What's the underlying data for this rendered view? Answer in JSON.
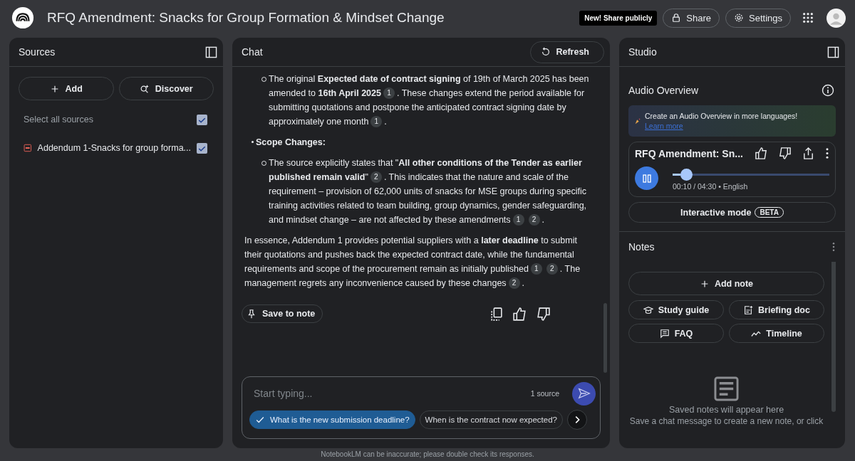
{
  "header": {
    "title": "RFQ Amendment: Snacks for Group Formation & Mindset Change",
    "promo": "New! Share publicly",
    "share": "Share",
    "settings": "Settings"
  },
  "sources": {
    "title": "Sources",
    "add": "Add",
    "discover": "Discover",
    "select_all": {
      "label": "Select all sources",
      "checked": true
    },
    "items": [
      {
        "name": "Addendum 1-Snacks for group forma...",
        "checked": true
      }
    ]
  },
  "chat": {
    "title": "Chat",
    "refresh": "Refresh",
    "blocks": [
      {
        "kind": "sub",
        "parts": [
          {
            "kind": "text",
            "text": "The original **Expected date of contract signing** of 19th of March 2025 has been amended to **16th April 2025**"
          },
          {
            "kind": "cite",
            "text": "1"
          },
          {
            "kind": "text",
            "text": ". These changes extend the period available for submitting quotations and postpone the anticipated contract signing date by approximately one month"
          },
          {
            "kind": "cite",
            "text": "1"
          },
          {
            "kind": "text",
            "text": "."
          }
        ]
      },
      {
        "kind": "bullet",
        "parts": [
          {
            "kind": "text",
            "text": "**Scope Changes:**"
          }
        ]
      },
      {
        "kind": "sub",
        "parts": [
          {
            "kind": "text",
            "text": "The source explicitly states that \"**All other conditions of the Tender as earlier published remain valid**\""
          },
          {
            "kind": "cite",
            "text": "2"
          },
          {
            "kind": "text",
            "text": ". This indicates that the nature and scale of the requirement – provision of 62,000 units of snacks for MSE groups during specific training activities related to team building, group dynamics, gender safeguarding, and mindset change – are not affected by these amendments"
          },
          {
            "kind": "cite",
            "text": "1"
          },
          {
            "kind": "cite",
            "text": "2"
          },
          {
            "kind": "text",
            "text": "."
          }
        ]
      },
      {
        "kind": "para",
        "parts": [
          {
            "kind": "text",
            "text": "In essence, Addendum 1 provides potential suppliers with a **later deadline** to submit their quotations and pushes back the expected contract date, while the fundamental requirements and scope of the procurement remain as initially published"
          },
          {
            "kind": "cite",
            "text": "1"
          },
          {
            "kind": "cite",
            "text": "2"
          },
          {
            "kind": "text",
            "text": ". The management regrets any inconvenience caused by these changes"
          },
          {
            "kind": "cite",
            "text": "2"
          },
          {
            "kind": "text",
            "text": "."
          }
        ]
      }
    ],
    "save_to_note": "Save to note",
    "input": {
      "placeholder": "Start typing...",
      "source_count": "1 source"
    },
    "suggestions": [
      {
        "text": "What is the new submission deadline?",
        "selected": true
      },
      {
        "text": "When is the contract now expected?",
        "selected": false
      }
    ],
    "disclaimer": "NotebookLM can be inaccurate; please double check its responses."
  },
  "studio": {
    "title": "Studio",
    "audio_title": "Audio Overview",
    "banner": "Create an Audio Overview in more languages!",
    "banner_link": "Learn more",
    "player": {
      "title": "RFQ Amendment: Sn...",
      "level": 0.05,
      "meta": "00:10 / 04:30 • English",
      "playing": true
    },
    "interactive": "Interactive mode",
    "beta": "BETA",
    "notes_title": "Notes",
    "add_note": "Add note",
    "note_buttons": [
      {
        "kind": "study",
        "label": "Study guide"
      },
      {
        "kind": "briefing",
        "label": "Briefing doc"
      },
      {
        "kind": "faq",
        "label": "FAQ"
      },
      {
        "kind": "timeline",
        "label": "Timeline"
      }
    ],
    "empty_title": "Saved notes will appear here",
    "empty_text": "Save a chat message to create a new note, or click"
  }
}
